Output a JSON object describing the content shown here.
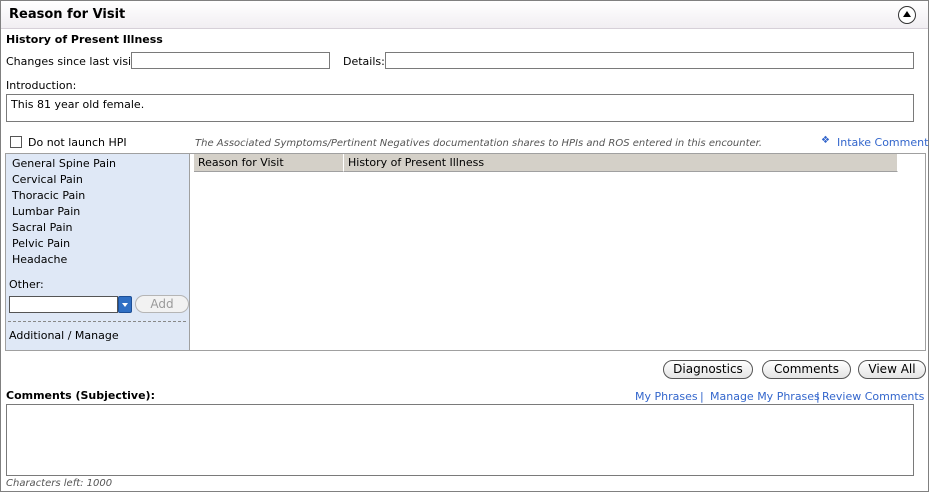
{
  "header": {
    "title": "Reason for Visit"
  },
  "hpi": {
    "heading": "History of Present Illness",
    "changes_label": "Changes since last visit:",
    "changes_value": "",
    "details_label": "Details:",
    "details_value": "",
    "intro_label": "Introduction:",
    "intro_value": "This 81 year old female.",
    "dont_launch_label": "Do not launch HPI",
    "note": "The Associated Symptoms/Pertinent Negatives documentation shares to HPIs and ROS entered in this encounter.",
    "intake_icon": "❖",
    "intake_label": "Intake Comments"
  },
  "sidebar": {
    "items": [
      "General Spine Pain",
      "Cervical Pain",
      "Thoracic Pain",
      "Lumbar Pain",
      "Sacral Pain",
      "Pelvic Pain",
      "Headache"
    ],
    "other_label": "Other:",
    "other_value": "",
    "add_label": "Add",
    "manage_label": "Additional / Manage"
  },
  "grid": {
    "columns": [
      "Reason for Visit",
      "History of Present Illness"
    ]
  },
  "buttons": {
    "diagnostics": "Diagnostics",
    "comments": "Comments",
    "view_all": "View All"
  },
  "comments": {
    "label": "Comments (Subjective):",
    "my_phrases": "My Phrases",
    "sep1": "|",
    "manage_phrases": "Manage My Phrases",
    "sep2": "|",
    "review_comments": "Review Comments",
    "value": "",
    "chars_left": "Characters left: 1000"
  }
}
